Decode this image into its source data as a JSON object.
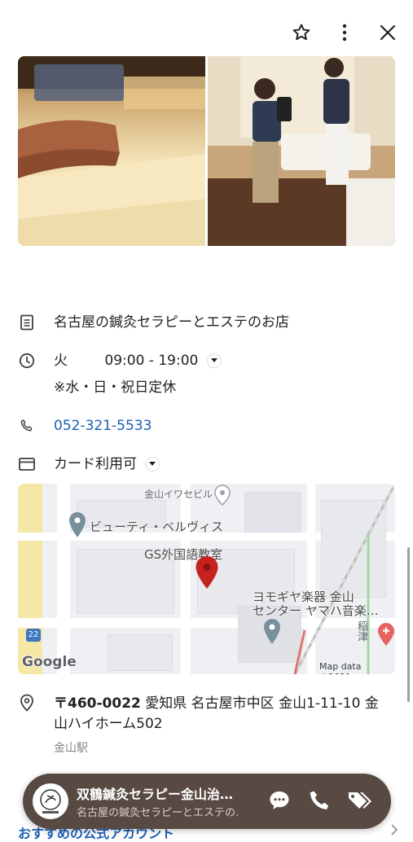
{
  "header": {
    "star_icon": "star-outline-icon",
    "more_icon": "more-vert-icon",
    "close_icon": "close-icon"
  },
  "details": {
    "description": "名古屋の鍼灸セラピーとエステのお店",
    "hours": {
      "day": "火",
      "time": "09:00 - 19:00",
      "note": "※水・日・祝日定休"
    },
    "phone": "052-321-5533",
    "payment": "カード利用可"
  },
  "map": {
    "labels": {
      "kanayama_iwaseibiru": "金山イワセビル",
      "beauty_belvis": "ビューティ・ベルヴィス",
      "gs_school": "GS外国語教室",
      "yomogiya_line1": "ヨモギヤ楽器 金山",
      "yomogiya_line2": "センター ヤマハ音楽…",
      "route_number": "22",
      "side_text": "稲津",
      "google_logo": "Google",
      "map_data": "Map data ©2021"
    }
  },
  "address": {
    "postal": "〒460-0022",
    "line1": "愛知県 名古屋市中区 金山1-11-10 金",
    "line2": "山ハイホーム502",
    "station": "金山駅"
  },
  "bottom_bar": {
    "name": "双鶴鍼灸セラピー金山治…",
    "subtitle": "名古屋の鍼灸セラピーとエステの…",
    "colors": {
      "bar": "#584a42"
    }
  },
  "footer": {
    "partial_text": "おすすめの公式アカウント"
  },
  "colors": {
    "link": "#1a73e8",
    "pin": "#c5221f"
  }
}
